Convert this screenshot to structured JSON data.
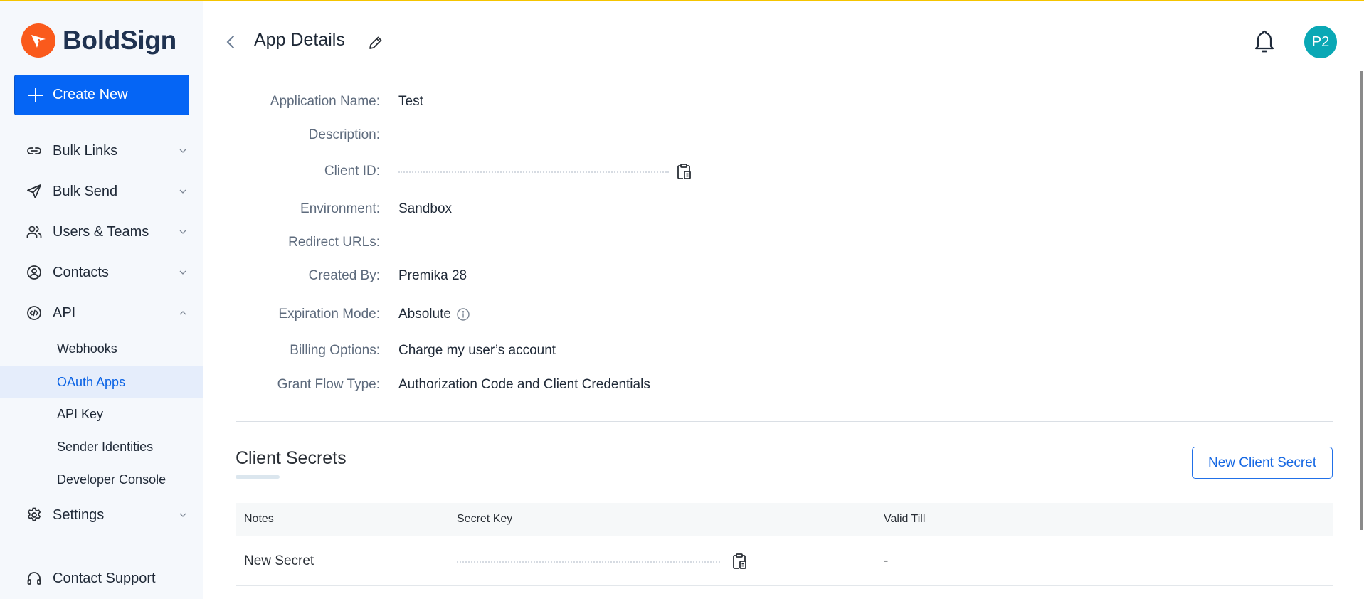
{
  "app": {
    "brand": "BoldSign",
    "accent_color": "#0565f5",
    "brand_color": "#fa5a1c"
  },
  "sidebar": {
    "create_label": "Create New",
    "items": [
      {
        "label": "Bulk Links",
        "icon": "link-icon",
        "expanded": false
      },
      {
        "label": "Bulk Send",
        "icon": "send-icon",
        "expanded": false
      },
      {
        "label": "Users & Teams",
        "icon": "users-icon",
        "expanded": false
      },
      {
        "label": "Contacts",
        "icon": "contact-icon",
        "expanded": false
      },
      {
        "label": "API",
        "icon": "code-icon",
        "expanded": true
      },
      {
        "label": "Settings",
        "icon": "gear-icon",
        "expanded": false
      }
    ],
    "api_subitems": [
      {
        "label": "Webhooks",
        "active": false
      },
      {
        "label": "OAuth Apps",
        "active": true
      },
      {
        "label": "API Key",
        "active": false
      },
      {
        "label": "Sender Identities",
        "active": false
      },
      {
        "label": "Developer Console",
        "active": false
      }
    ],
    "support_label": "Contact Support"
  },
  "header": {
    "title": "App Details",
    "avatar_initials": "P2"
  },
  "details": {
    "fields": [
      {
        "label": "Application Name:",
        "value": "Test"
      },
      {
        "label": "Description:",
        "value": ""
      },
      {
        "label": "Client ID:",
        "value": ""
      },
      {
        "label": "Environment:",
        "value": "Sandbox"
      },
      {
        "label": "Redirect URLs:",
        "value": ""
      },
      {
        "label": "Created By:",
        "value": "Premika 28"
      },
      {
        "label": "Expiration Mode:",
        "value": "Absolute"
      },
      {
        "label": "Billing Options:",
        "value": "Charge my user’s account"
      },
      {
        "label": "Grant Flow Type:",
        "value": "Authorization Code and Client Credentials"
      }
    ]
  },
  "client_secrets": {
    "title": "Client Secrets",
    "new_button_label": "New Client Secret",
    "columns": [
      "Notes",
      "Secret Key",
      "Valid Till"
    ],
    "rows": [
      {
        "notes": "New Secret",
        "secret_key": "",
        "valid_till": "-"
      }
    ]
  }
}
